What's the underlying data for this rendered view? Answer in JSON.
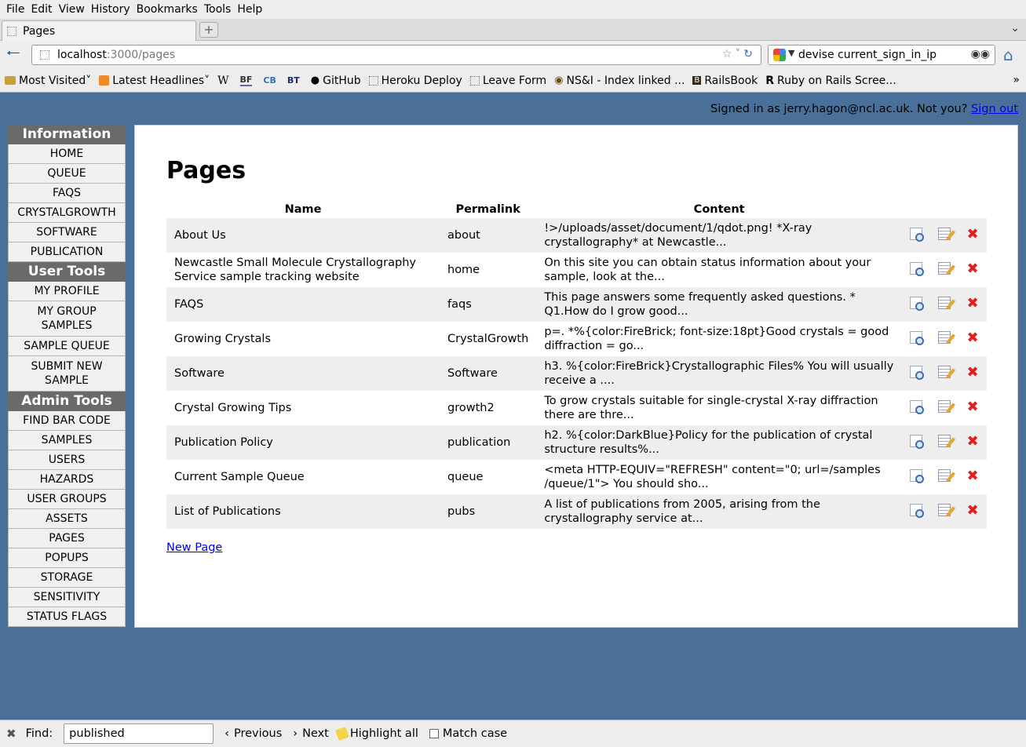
{
  "menu": [
    "File",
    "Edit",
    "View",
    "History",
    "Bookmarks",
    "Tools",
    "Help"
  ],
  "tab": {
    "title": "Pages"
  },
  "tab_list_icon": "chevron-down-icon",
  "url": {
    "host": "localhost",
    "path": ":3000/pages"
  },
  "search": {
    "value": "devise current_sign_in_ip"
  },
  "bookmarks": [
    {
      "label": "Most Visited",
      "icon": "folder-icon",
      "dropdown": true
    },
    {
      "label": "Latest Headlines",
      "icon": "rss-icon",
      "dropdown": true
    },
    {
      "label": "W",
      "icon": "wikipedia-icon"
    },
    {
      "label": "BF",
      "icon": "bf-icon"
    },
    {
      "label": "CB",
      "icon": "cb-icon"
    },
    {
      "label": "BT",
      "icon": "bt-icon"
    },
    {
      "label": "GitHub",
      "icon": "github-icon"
    },
    {
      "label": "Heroku Deploy",
      "icon": "page-icon"
    },
    {
      "label": "Leave Form",
      "icon": "page-icon"
    },
    {
      "label": "NS&I - Index linked ...",
      "icon": "nsi-icon"
    },
    {
      "label": "RailsBook",
      "icon": "railsbook-icon"
    },
    {
      "label": "Ruby on Rails Scree...",
      "icon": "rails-icon"
    }
  ],
  "user": {
    "signed_in_text": "Signed in as jerry.hagon@ncl.ac.uk. Not you?",
    "sign_out": "Sign out"
  },
  "sidebar": {
    "sections": [
      {
        "title": "Information",
        "items": [
          "HOME",
          "QUEUE",
          "FAQS",
          "CRYSTALGROWTH",
          "SOFTWARE",
          "PUBLICATION"
        ]
      },
      {
        "title": "User Tools",
        "items": [
          "MY PROFILE",
          "MY GROUP SAMPLES",
          "SAMPLE QUEUE",
          "SUBMIT NEW SAMPLE"
        ]
      },
      {
        "title": "Admin Tools",
        "items": [
          "FIND BAR CODE",
          "SAMPLES",
          "USERS",
          "HAZARDS",
          "USER GROUPS",
          "ASSETS",
          "PAGES",
          "POPUPS",
          "STORAGE",
          "SENSITIVITY",
          "STATUS FLAGS"
        ]
      }
    ]
  },
  "main": {
    "title": "Pages",
    "columns": [
      "Name",
      "Permalink",
      "Content"
    ],
    "rows": [
      {
        "name": "About Us",
        "permalink": "about",
        "content": "!>/uploads/asset/document/1/qdot.png! *X-ray crystallography* at Newcastle..."
      },
      {
        "name": "Newcastle Small Molecule Crystallography Service sample tracking website",
        "permalink": "home",
        "content": "On this site you can obtain status information about your sample, look at the..."
      },
      {
        "name": "FAQS",
        "permalink": "faqs",
        "content": "This page answers some frequently asked questions. * Q1.How do I grow good..."
      },
      {
        "name": "Growing Crystals",
        "permalink": "CrystalGrowth",
        "content": "p=. *%{color:FireBrick; font-size:18pt}Good crystals = good diffraction = go..."
      },
      {
        "name": "Software",
        "permalink": "Software",
        "content": "h3. %{color:FireBrick}Crystallographic Files% You will usually receive a ...."
      },
      {
        "name": "Crystal Growing Tips",
        "permalink": "growth2",
        "content": "To grow crystals suitable for single-crystal X-ray diffraction there are thre..."
      },
      {
        "name": "Publication Policy",
        "permalink": "publication",
        "content": "h2. %{color:DarkBlue}Policy for the publication of crystal structure results%..."
      },
      {
        "name": "Current Sample Queue",
        "permalink": "queue",
        "content": "<meta HTTP-EQUIV=\"REFRESH\" content=\"0; url=/samples /queue/1\"> You should sho..."
      },
      {
        "name": "List of Publications",
        "permalink": "pubs",
        "content": "A list of publications from 2005, arising from the crystallography service at..."
      }
    ],
    "row_actions": [
      "show-icon",
      "edit-icon",
      "delete-icon"
    ],
    "new_link": "New Page"
  },
  "findbar": {
    "label": "Find:",
    "value": "published",
    "previous": "Previous",
    "next": "Next",
    "highlight_all": "Highlight all",
    "match_case": "Match case"
  }
}
